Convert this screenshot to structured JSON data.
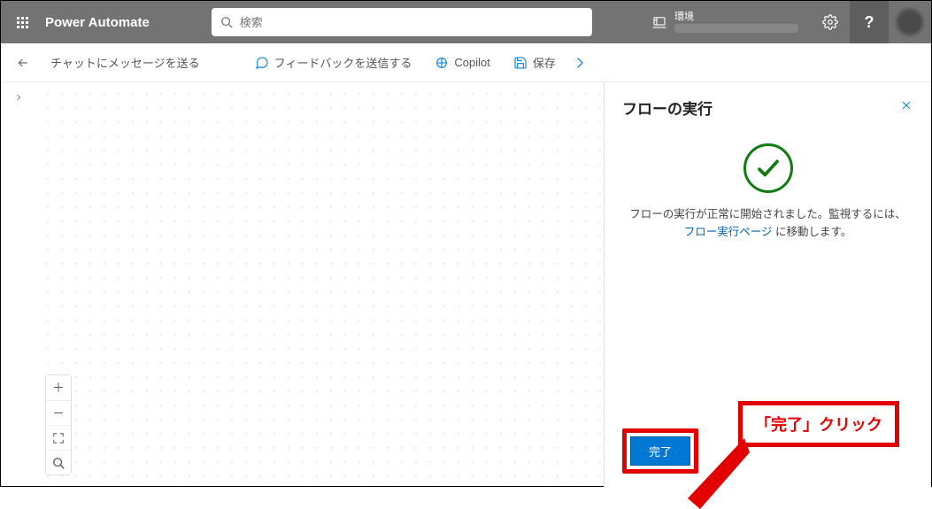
{
  "header": {
    "brand": "Power Automate",
    "search_placeholder": "検索",
    "env_label": "環境"
  },
  "cmdbar": {
    "flow_title": "チャットにメッセージを送る",
    "feedback": "フィードバックを送信する",
    "copilot": "Copilot",
    "save": "保存"
  },
  "panel": {
    "title": "フローの実行",
    "message_prefix": "フローの実行が正常に開始されました。監視するには、",
    "link_text": "フロー実行ページ",
    "message_suffix": " に移動します。",
    "done": "完了"
  },
  "callout": {
    "text": "「完了」クリック"
  }
}
